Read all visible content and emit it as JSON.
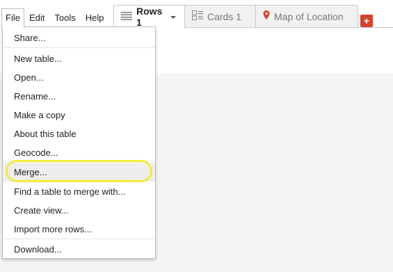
{
  "menubar": {
    "items": [
      {
        "label": "File"
      },
      {
        "label": "Edit"
      },
      {
        "label": "Tools"
      },
      {
        "label": "Help"
      }
    ]
  },
  "tabs": [
    {
      "label": "Rows 1",
      "icon": "rows-icon",
      "active": true
    },
    {
      "label": "Cards 1",
      "icon": "cards-icon",
      "active": false
    },
    {
      "label": "Map of Location",
      "icon": "map-pin-icon",
      "active": false
    }
  ],
  "add_tab": {
    "label": "+",
    "color": "#d9412e"
  },
  "file_menu": {
    "items": [
      {
        "label": "Share..."
      },
      {
        "label": "New table..."
      },
      {
        "label": "Open..."
      },
      {
        "label": "Rename..."
      },
      {
        "label": "Make a copy"
      },
      {
        "label": "About this table"
      },
      {
        "label": "Geocode..."
      },
      {
        "label": "Merge..."
      },
      {
        "label": "Find a table to merge with..."
      },
      {
        "label": "Create view..."
      },
      {
        "label": "Import more rows..."
      },
      {
        "label": "Download..."
      }
    ],
    "highlighted_item": "Merge...",
    "highlight_ring_color": "#f0ec3a"
  },
  "colors": {
    "content_background": "#f4f4f4",
    "map_pin": "#d9412e"
  }
}
